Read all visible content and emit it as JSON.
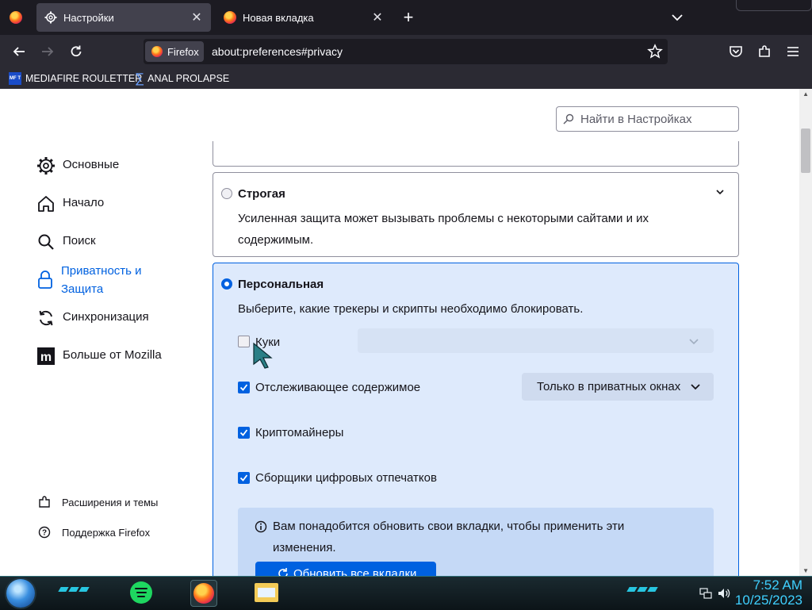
{
  "tabs": [
    {
      "label": "Настройки",
      "active": true
    },
    {
      "label": "Новая вкладка",
      "active": false
    }
  ],
  "urlbar": {
    "identity_label": "Firefox",
    "url": "about:preferences#privacy"
  },
  "bookmarks": [
    {
      "label": "MEDIAFIRE ROULETTER",
      "icon": "mediafire-icon"
    },
    {
      "label": "ANAL PROLAPSE",
      "icon": "sigma-icon"
    }
  ],
  "search": {
    "placeholder": "Найти в Настройках"
  },
  "categories": [
    {
      "label": "Основные",
      "icon": "gear-icon"
    },
    {
      "label": "Начало",
      "icon": "home-icon"
    },
    {
      "label": "Поиск",
      "icon": "search-icon"
    },
    {
      "label": "Приватность и Защита",
      "icon": "lock-icon",
      "selected": true
    },
    {
      "label": "Синхронизация",
      "icon": "sync-icon"
    },
    {
      "label": "Больше от Mozilla",
      "icon": "mozilla-icon"
    }
  ],
  "footer_links": [
    {
      "label": "Расширения и темы",
      "icon": "puzzle-icon"
    },
    {
      "label": "Поддержка Firefox",
      "icon": "help-icon"
    }
  ],
  "protection": {
    "strict": {
      "title": "Строгая",
      "description": "Усиленная защита может вызывать проблемы с некоторыми сайтами и их содержимым."
    },
    "custom": {
      "title": "Персональная",
      "description": "Выберите, какие трекеры и скрипты необходимо блокировать.",
      "options": [
        {
          "label": "Куки",
          "checked": false
        },
        {
          "label": "Отслеживающее содержимое",
          "checked": true,
          "select_value": "Только в приватных окнах"
        },
        {
          "label": "Криптомайнеры",
          "checked": true
        },
        {
          "label": "Сборщики цифровых отпечатков",
          "checked": true
        }
      ],
      "info_text": "Вам понадобится обновить свои вкладки, чтобы применить эти изменения.",
      "reload_button": "Обновить все вкладки"
    }
  },
  "taskbar": {
    "time": "7:52 AM",
    "date": "10/25/2023"
  },
  "colors": {
    "accent": "#0061e0",
    "chrome_dark": "#1c1b22",
    "chrome_toolbar": "#2b2a33",
    "custom_card_bg": "#deeafc",
    "clock": "#3fd0ff"
  }
}
